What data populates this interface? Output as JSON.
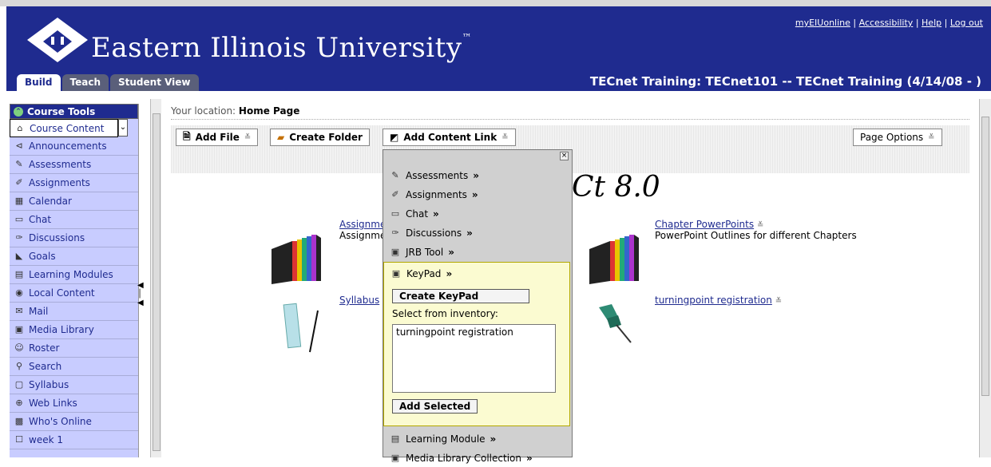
{
  "brand": {
    "name": "Eastern Illinois University",
    "trademark": "™",
    "colors": {
      "header_blue": "#1f2b8f",
      "sidebar": "#c8ccff",
      "keypad_panel": "#fbfbd1",
      "link": "#1f2b8f"
    }
  },
  "top_links": [
    "myEIUonline",
    "Accessibility",
    "Help",
    "Log out"
  ],
  "top_link_separator": "|",
  "tabs": [
    {
      "label": "Build",
      "active": true
    },
    {
      "label": "Teach",
      "active": false
    },
    {
      "label": "Student View",
      "active": false
    }
  ],
  "course_title": "TECnet Training: TECnet101 -- TECnet Training (4/14/08 - )",
  "sidebar": {
    "header": "Course Tools",
    "items": [
      {
        "label": "Course Content",
        "icon": "home-icon"
      },
      {
        "label": "Announcements",
        "icon": "megaphone-icon"
      },
      {
        "label": "Assessments",
        "icon": "assessment-icon"
      },
      {
        "label": "Assignments",
        "icon": "assignment-icon"
      },
      {
        "label": "Calendar",
        "icon": "calendar-icon"
      },
      {
        "label": "Chat",
        "icon": "chat-icon"
      },
      {
        "label": "Discussions",
        "icon": "pushpin-icon"
      },
      {
        "label": "Goals",
        "icon": "goals-icon"
      },
      {
        "label": "Learning Modules",
        "icon": "module-icon"
      },
      {
        "label": "Local Content",
        "icon": "local-content-icon"
      },
      {
        "label": "Mail",
        "icon": "mail-icon"
      },
      {
        "label": "Media Library",
        "icon": "media-library-icon"
      },
      {
        "label": "Roster",
        "icon": "roster-icon"
      },
      {
        "label": "Search",
        "icon": "search-icon"
      },
      {
        "label": "Syllabus",
        "icon": "syllabus-icon"
      },
      {
        "label": "Web Links",
        "icon": "web-links-icon"
      },
      {
        "label": "Who's Online",
        "icon": "whos-online-icon"
      },
      {
        "label": "week 1",
        "icon": "folder-icon"
      }
    ]
  },
  "location": {
    "prefix": "Your location:",
    "page": "Home Page"
  },
  "action_bar": {
    "add_file": "Add File",
    "create_folder": "Create Folder",
    "add_content_link": "Add Content Link",
    "page_options": "Page Options"
  },
  "big_title_fragment": "Ct 8.0",
  "content_items": [
    {
      "link": "Assignme",
      "desc": "Assignme"
    },
    {
      "link": "Syllabus",
      "desc": ""
    },
    {
      "link": "Chapter PowerPoints",
      "desc": "PowerPoint Outlines for different Chapters"
    },
    {
      "link": "turningpoint registration",
      "desc": ""
    }
  ],
  "dropdown": {
    "close": "×",
    "items_top": [
      "Assessments",
      "Assignments",
      "Chat",
      "Discussions",
      "JRB Tool"
    ],
    "chevron": "»",
    "keypad": {
      "label": "KeyPad",
      "create_button": "Create KeyPad",
      "select_label": "Select from inventory:",
      "inventory": [
        "turningpoint registration"
      ],
      "add_selected": "Add Selected"
    },
    "items_bottom": [
      "Learning Module",
      "Media Library Collection"
    ]
  }
}
